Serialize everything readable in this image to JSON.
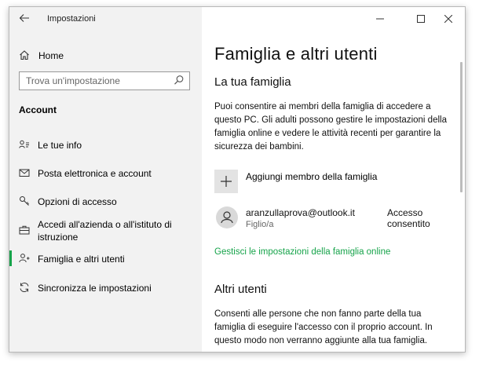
{
  "window": {
    "title": "Impostazioni",
    "back_icon": "back-arrow-icon",
    "controls": [
      "minimize-icon",
      "maximize-icon",
      "close-icon"
    ]
  },
  "sidebar": {
    "home_label": "Home",
    "search_placeholder": "Trova un'impostazione",
    "section_label": "Account",
    "items": [
      {
        "label": "Le tue info",
        "icon": "person-card-icon",
        "active": false
      },
      {
        "label": "Posta elettronica e account",
        "icon": "mail-icon",
        "active": false
      },
      {
        "label": "Opzioni di accesso",
        "icon": "key-icon",
        "active": false
      },
      {
        "label": "Accedi all'azienda o all'istituto di istruzione",
        "icon": "briefcase-icon",
        "active": false
      },
      {
        "label": "Famiglia e altri utenti",
        "icon": "people-icon",
        "active": true
      },
      {
        "label": "Sincronizza le impostazioni",
        "icon": "sync-icon",
        "active": false
      }
    ],
    "accent_color": "#16a34a"
  },
  "main": {
    "title": "Famiglia e altri utenti",
    "family": {
      "heading": "La tua famiglia",
      "description": "Puoi consentire ai membri della famiglia di accedere a questo PC. Gli adulti possono gestire le impostazioni della famiglia online e vedere le attività recenti per garantire la sicurezza dei bambini.",
      "add_label": "Aggiungi membro della famiglia",
      "member": {
        "email": "aranzullaprova@outlook.it",
        "role": "Figlio/a",
        "status": "Accesso consentito"
      },
      "manage_link": "Gestisci le impostazioni della famiglia online"
    },
    "others": {
      "heading": "Altri utenti",
      "description": "Consenti alle persone che non fanno parte della tua famiglia di eseguire l'accesso con il proprio account. In questo modo non verranno aggiunte alla tua famiglia."
    }
  }
}
